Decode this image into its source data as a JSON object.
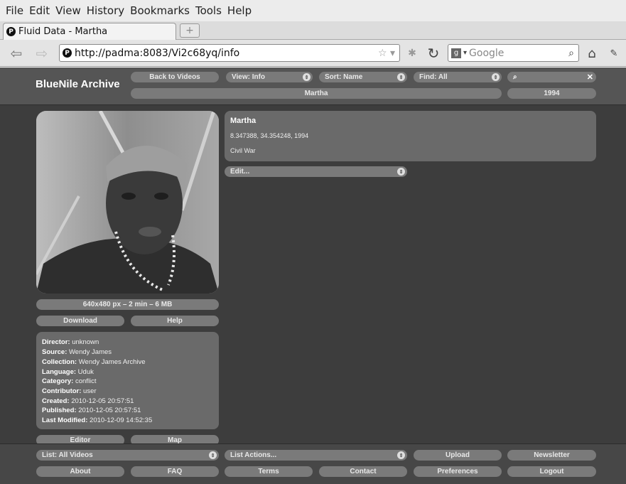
{
  "browser": {
    "menu": [
      "File",
      "Edit",
      "View",
      "History",
      "Bookmarks",
      "Tools",
      "Help"
    ],
    "tab_title": "Fluid Data - Martha",
    "favicon_letter": "P",
    "url": "http://padma:8083/Vi2c68yq/info",
    "search_placeholder": "Google",
    "icons": [
      "back-arrow-icon",
      "forward-arrow-icon",
      "bookmark-star-icon",
      "reload-icon",
      "search-icon",
      "home-icon",
      "extension-icon"
    ]
  },
  "header": {
    "app_name": "BlueNile Archive",
    "back_button": "Back to Videos",
    "view_select": "View: Info",
    "sort_select": "Sort: Name",
    "find_select": "Find: All",
    "find_input": "",
    "title_bar": "Martha",
    "year_bar": "1994"
  },
  "video": {
    "info_bar": "640x480 px – 2 min – 6 MB",
    "download_button": "Download",
    "help_button": "Help"
  },
  "metadata": [
    {
      "label": "Director:",
      "value": "unknown"
    },
    {
      "label": "Source:",
      "value": "Wendy James"
    },
    {
      "label": "Collection:",
      "value": "Wendy James Archive"
    },
    {
      "label": "Language:",
      "value": "Uduk"
    },
    {
      "label": "Category:",
      "value": "conflict"
    },
    {
      "label": "Contributor:",
      "value": "user"
    },
    {
      "label": "Created:",
      "value": "2010-12-05 20:57:51"
    },
    {
      "label": "Published:",
      "value": "2010-12-05 20:57:51"
    },
    {
      "label": "Last Modified:",
      "value": "2010-12-09 14:52:35"
    }
  ],
  "editor_button": "Editor",
  "map_button": "Map",
  "info": {
    "title": "Martha",
    "location": "8.347388, 34.354248, 1994",
    "topic": "Civil War",
    "edit_select": "Edit..."
  },
  "footer": {
    "list_select": "List: All Videos",
    "list_actions_select": "List Actions...",
    "upload_button": "Upload",
    "newsletter_button": "Newsletter",
    "about_button": "About",
    "faq_button": "FAQ",
    "terms_button": "Terms",
    "contact_button": "Contact",
    "preferences_button": "Preferences",
    "logout_button": "Logout"
  }
}
